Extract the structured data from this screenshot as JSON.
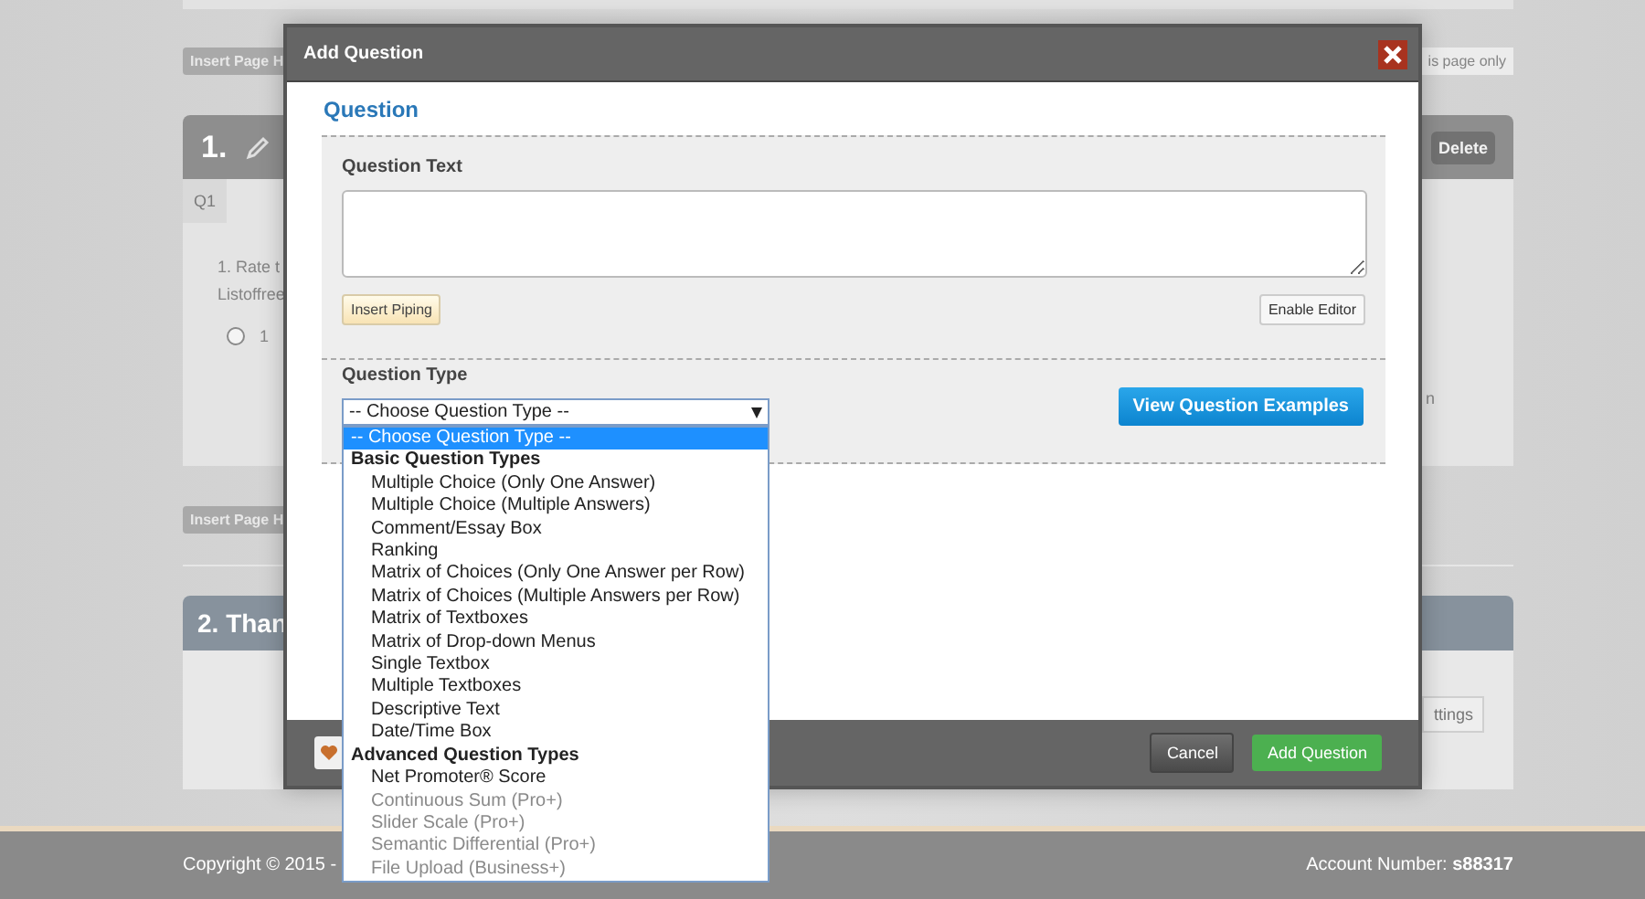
{
  "background_page": {
    "insert_page_buttons": [
      "Insert Page H",
      "Insert Page H"
    ],
    "page_only_button": "is page only",
    "block_1": {
      "number": "1.",
      "delete_button": "Delete",
      "tab": "Q1",
      "question_lines": [
        "1. Rate t",
        "Listoffree"
      ],
      "option_label": "1",
      "option_checked": false,
      "side_text": "n"
    },
    "block_2": {
      "title": "2. Than",
      "settings_button": "ttings"
    }
  },
  "dialog": {
    "title": "Add Question",
    "section_title": "Question",
    "question_text": {
      "label": "Question Text",
      "insert_piping_button": "Insert Piping",
      "enable_editor_button": "Enable Editor"
    },
    "question_type": {
      "label": "Question Type",
      "select_value": "-- Choose Question Type --",
      "expanded": true,
      "examples_button": "View Question Examples",
      "options": [
        {
          "kind": "option",
          "label": "-- Choose Question Type --",
          "selected": true,
          "disabled": false
        },
        {
          "kind": "group",
          "label": "Basic Question Types"
        },
        {
          "kind": "option",
          "label": "Multiple Choice (Only One Answer)",
          "selected": false,
          "disabled": false
        },
        {
          "kind": "option",
          "label": "Multiple Choice (Multiple Answers)",
          "selected": false,
          "disabled": false
        },
        {
          "kind": "option",
          "label": "Comment/Essay Box",
          "selected": false,
          "disabled": false
        },
        {
          "kind": "option",
          "label": "Ranking",
          "selected": false,
          "disabled": false
        },
        {
          "kind": "option",
          "label": "Matrix of Choices (Only One Answer per Row)",
          "selected": false,
          "disabled": false
        },
        {
          "kind": "option",
          "label": "Matrix of Choices (Multiple Answers per Row)",
          "selected": false,
          "disabled": false
        },
        {
          "kind": "option",
          "label": "Matrix of Textboxes",
          "selected": false,
          "disabled": false
        },
        {
          "kind": "option",
          "label": "Matrix of Drop-down Menus",
          "selected": false,
          "disabled": false
        },
        {
          "kind": "option",
          "label": "Single Textbox",
          "selected": false,
          "disabled": false
        },
        {
          "kind": "option",
          "label": "Multiple Textboxes",
          "selected": false,
          "disabled": false
        },
        {
          "kind": "option",
          "label": "Descriptive Text",
          "selected": false,
          "disabled": false
        },
        {
          "kind": "option",
          "label": "Date/Time Box",
          "selected": false,
          "disabled": false
        },
        {
          "kind": "group",
          "label": "Advanced Question Types"
        },
        {
          "kind": "option",
          "label": "Net Promoter® Score",
          "selected": false,
          "disabled": false
        },
        {
          "kind": "option",
          "label": "Continuous Sum (Pro+)",
          "selected": false,
          "disabled": true
        },
        {
          "kind": "option",
          "label": "Slider Scale (Pro+)",
          "selected": false,
          "disabled": true
        },
        {
          "kind": "option",
          "label": "Semantic Differential (Pro+)",
          "selected": false,
          "disabled": true
        },
        {
          "kind": "option",
          "label": "File Upload (Business+)",
          "selected": false,
          "disabled": true
        }
      ]
    },
    "footer_buttons": [
      {
        "kind": "cancel",
        "label": "Cancel"
      },
      {
        "kind": "primary",
        "label": "Add Question"
      }
    ]
  },
  "footer": {
    "copyright": "Copyright © 2015 -",
    "account": "Account Number: **s88317**"
  }
}
